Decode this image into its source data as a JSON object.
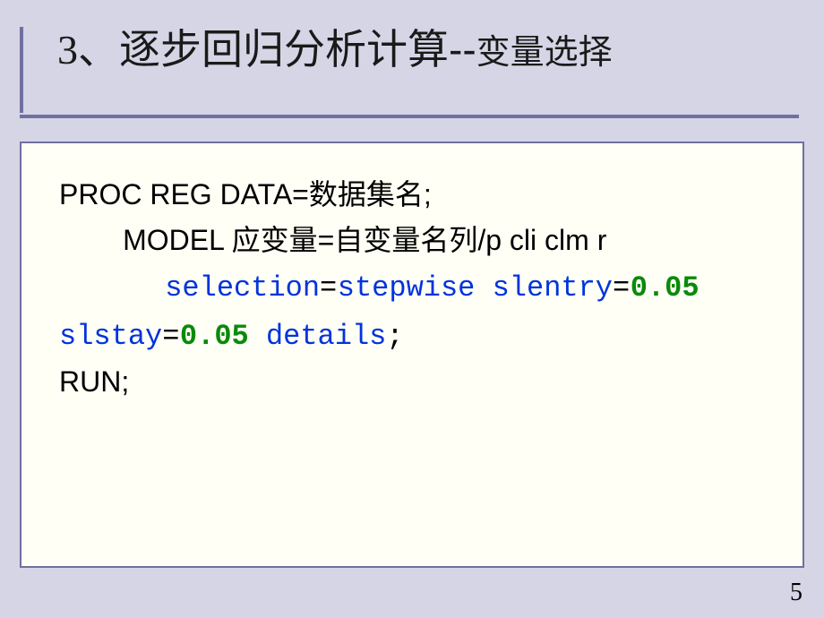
{
  "title": {
    "prefix": "3、逐步回归分析计算",
    "dash": "--",
    "suffix": "变量选择"
  },
  "code": {
    "l1a": "PROC REG DATA=",
    "l1b": "数据集名",
    "l1c": ";",
    "l2ind": "        ",
    "l2a": "MODEL ",
    "l2b": "应变量",
    "l2c": "=",
    "l2d": "自变量名列",
    "l2e": "/p cli clm r",
    "l3ind": "      ",
    "l3a": "selection",
    "l3b": "=",
    "l3c": "stepwise ",
    "l3d": "slentry",
    "l3e": "=",
    "l3f": "0.05",
    "l4a": "slstay",
    "l4b": "=",
    "l4c": "0.05",
    "l4d": " details",
    "l4e": ";",
    "l5": "RUN;"
  },
  "page_number": "5"
}
